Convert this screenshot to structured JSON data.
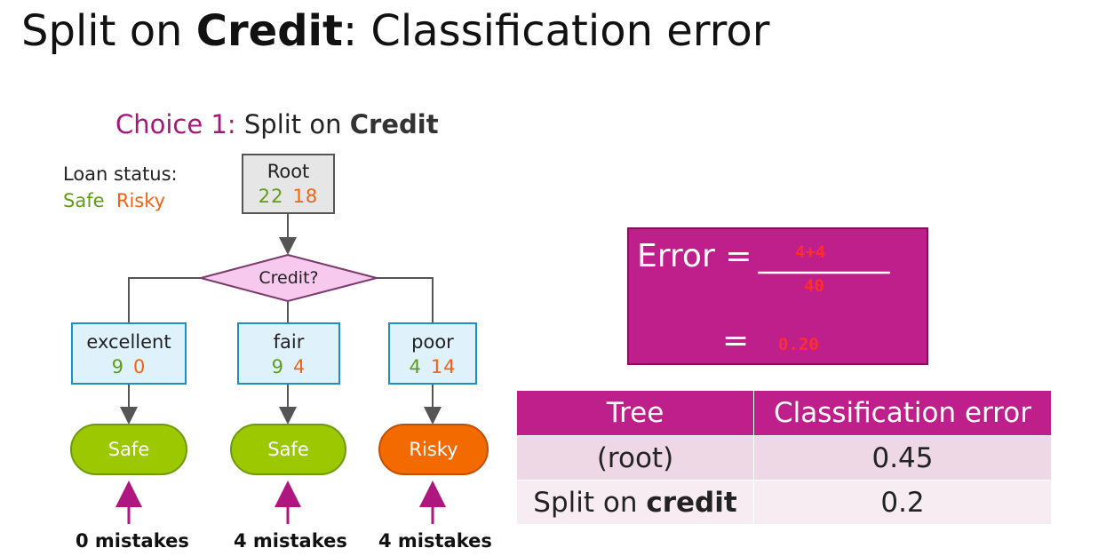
{
  "title": {
    "prefix": "Split on ",
    "bold": "Credit",
    "suffix": ": Classification error"
  },
  "subtitle": {
    "choice": "Choice 1:",
    "text": " Split on ",
    "bold": "Credit"
  },
  "legend": {
    "title": "Loan status:",
    "safe": "Safe",
    "risky": "Risky"
  },
  "colors": {
    "safe": "#5f9c1c",
    "risky": "#f06414",
    "accent": "#bf1f8a",
    "leaf_safe": "#9bc800",
    "leaf_risky": "#f26a00"
  },
  "tree": {
    "root": {
      "label": "Root",
      "safe": "22",
      "risky": "18"
    },
    "decision": {
      "label": "Credit?"
    },
    "branches": [
      {
        "label": "excellent",
        "safe": "9",
        "risky": "0",
        "prediction": "Safe",
        "mistakes": "0 mistakes"
      },
      {
        "label": "fair",
        "safe": "9",
        "risky": "4",
        "prediction": "Safe",
        "mistakes": "4 mistakes"
      },
      {
        "label": "poor",
        "safe": "4",
        "risky": "14",
        "prediction": "Risky",
        "mistakes": "4 mistakes"
      }
    ]
  },
  "error_box": {
    "label": "Error =",
    "eq": "=",
    "numerator": "4+4",
    "denominator": "40",
    "result": "0.20"
  },
  "table": {
    "headers": [
      "Tree",
      "Classification error"
    ],
    "rows": [
      {
        "tree": "(root)",
        "error": "0.45"
      },
      {
        "tree_prefix": "Split on ",
        "tree_bold": "credit",
        "error": "0.2"
      }
    ]
  }
}
